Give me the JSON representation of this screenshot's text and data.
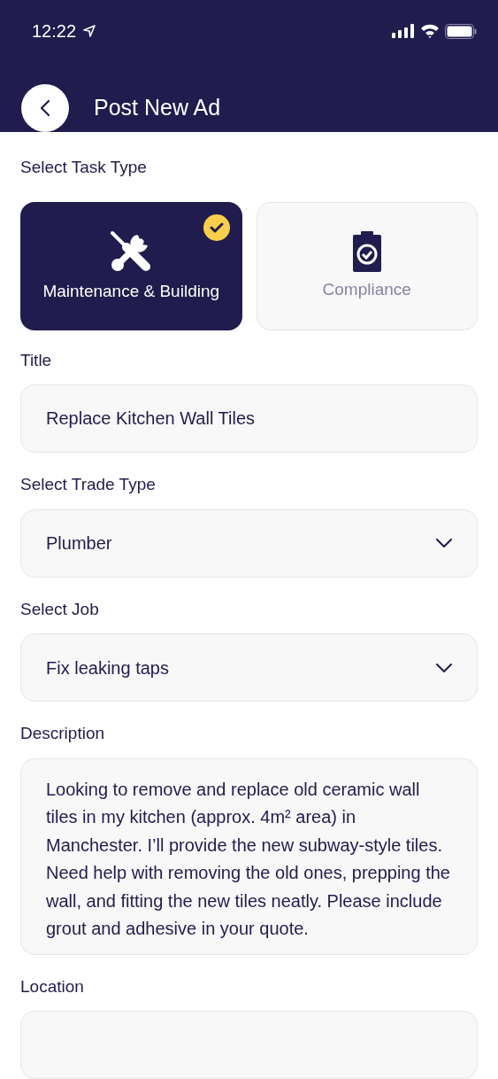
{
  "status_bar": {
    "time": "12:22"
  },
  "header": {
    "title": "Post New Ad"
  },
  "task_type": {
    "label": "Select Task Type",
    "options": [
      {
        "label": "Maintenance & Building",
        "kind": "tools",
        "selected": true
      },
      {
        "label": "Compliance",
        "kind": "clipboard",
        "selected": false
      }
    ]
  },
  "fields": [
    {
      "label": "Title",
      "kind": "text",
      "value": "Replace Kitchen Wall Tiles"
    },
    {
      "label": "Select Trade Type",
      "kind": "select",
      "value": "Plumber"
    },
    {
      "label": "Select Job",
      "kind": "select",
      "value": "Fix leaking taps"
    },
    {
      "label": "Description",
      "kind": "textarea",
      "value": "Looking to remove and replace old ceramic wall tiles in my kitchen (approx. 4m² area) in Manchester. I’ll provide the new subway-style tiles. Need help with removing the old ones, prepping the wall, and fitting the new tiles neatly. Please include grout and adhesive in your quote."
    },
    {
      "label": "Location",
      "kind": "text"
    }
  ]
}
